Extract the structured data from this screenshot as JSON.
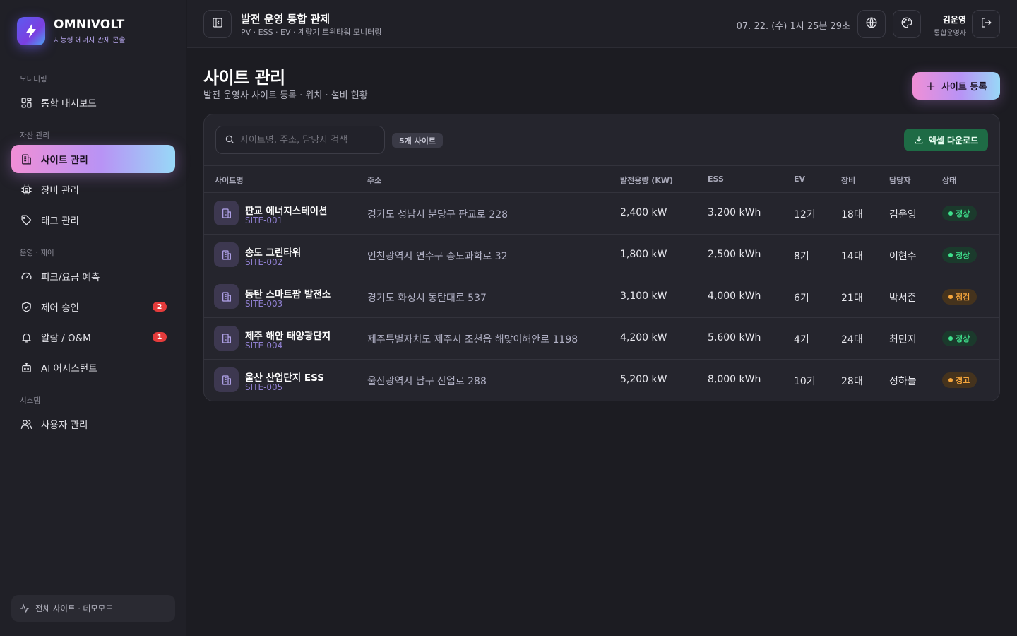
{
  "brand": {
    "name": "OMNIVOLT",
    "subtitle": "지능형 에너지 관제 콘솔"
  },
  "sidebar": {
    "sections": [
      {
        "label": "모니터링"
      },
      {
        "label": "자산 관리"
      },
      {
        "label": "운영 · 제어"
      },
      {
        "label": "시스템"
      }
    ],
    "items": [
      {
        "label": "통합 대시보드",
        "icon": "grid-icon"
      },
      {
        "label": "사이트 관리",
        "icon": "building-icon",
        "active": true
      },
      {
        "label": "장비 관리",
        "icon": "chip-icon"
      },
      {
        "label": "태그 관리",
        "icon": "tag-icon"
      },
      {
        "label": "피크/요금 예측",
        "icon": "gauge-icon"
      },
      {
        "label": "제어 승인",
        "icon": "shield-icon",
        "badge": "2"
      },
      {
        "label": "알람 / O&M",
        "icon": "bell-icon",
        "badge": "1"
      },
      {
        "label": "AI 어시스턴트",
        "icon": "bot-icon"
      },
      {
        "label": "사용자 관리",
        "icon": "users-icon"
      }
    ],
    "footer": "전체 사이트 · 데모모드"
  },
  "header": {
    "title": "발전 운영 통합 관제",
    "subtitle": "PV · ESS · EV · 계량기 트윈타워 모니터링",
    "datetime": "07. 22. (수) 1시 25분 29초",
    "user_name": "김운영",
    "user_role": "통합운영자"
  },
  "page": {
    "title": "사이트 관리",
    "subtitle": "발전 운영사 사이트 등록 · 위치 · 설비 현황",
    "add_button": "사이트 등록",
    "search_placeholder": "사이트명, 주소, 담당자 검색",
    "count_badge": "5개 사이트",
    "excel_button": "엑셀 다운로드"
  },
  "table": {
    "columns": [
      "사이트명",
      "주소",
      "발전용량 (KW)",
      "ESS",
      "EV",
      "장비",
      "담당자",
      "상태"
    ],
    "rows": [
      {
        "name": "판교 에너지스테이션",
        "code": "SITE-001",
        "address": "경기도 성남시 분당구 판교로 228",
        "capacity": "2,400 kW",
        "ess": "3,200 kWh",
        "ev": "12기",
        "equip": "18대",
        "manager": "김운영",
        "status": "정상",
        "status_type": "ok"
      },
      {
        "name": "송도 그린타워",
        "code": "SITE-002",
        "address": "인천광역시 연수구 송도과학로 32",
        "capacity": "1,800 kW",
        "ess": "2,500 kWh",
        "ev": "8기",
        "equip": "14대",
        "manager": "이현수",
        "status": "정상",
        "status_type": "ok"
      },
      {
        "name": "동탄 스마트팜 발전소",
        "code": "SITE-003",
        "address": "경기도 화성시 동탄대로 537",
        "capacity": "3,100 kW",
        "ess": "4,000 kWh",
        "ev": "6기",
        "equip": "21대",
        "manager": "박서준",
        "status": "점검",
        "status_type": "warn"
      },
      {
        "name": "제주 해안 태양광단지",
        "code": "SITE-004",
        "address": "제주특별자치도 제주시 조천읍 해맞이해안로 1198",
        "capacity": "4,200 kW",
        "ess": "5,600 kWh",
        "ev": "4기",
        "equip": "24대",
        "manager": "최민지",
        "status": "정상",
        "status_type": "ok"
      },
      {
        "name": "울산 산업단지 ESS",
        "code": "SITE-005",
        "address": "울산광역시 남구 산업로 288",
        "capacity": "5,200 kW",
        "ess": "8,000 kWh",
        "ev": "10기",
        "equip": "28대",
        "manager": "정하늘",
        "status": "경고",
        "status_type": "warn"
      }
    ]
  },
  "colors": {
    "accent_gradient": [
      "#f08fd6",
      "#b893f5",
      "#98d8f7"
    ],
    "ok": "#3fe08c",
    "warn": "#f6a63c",
    "badge": "#e53b3b",
    "excel": "#1e6b45"
  }
}
